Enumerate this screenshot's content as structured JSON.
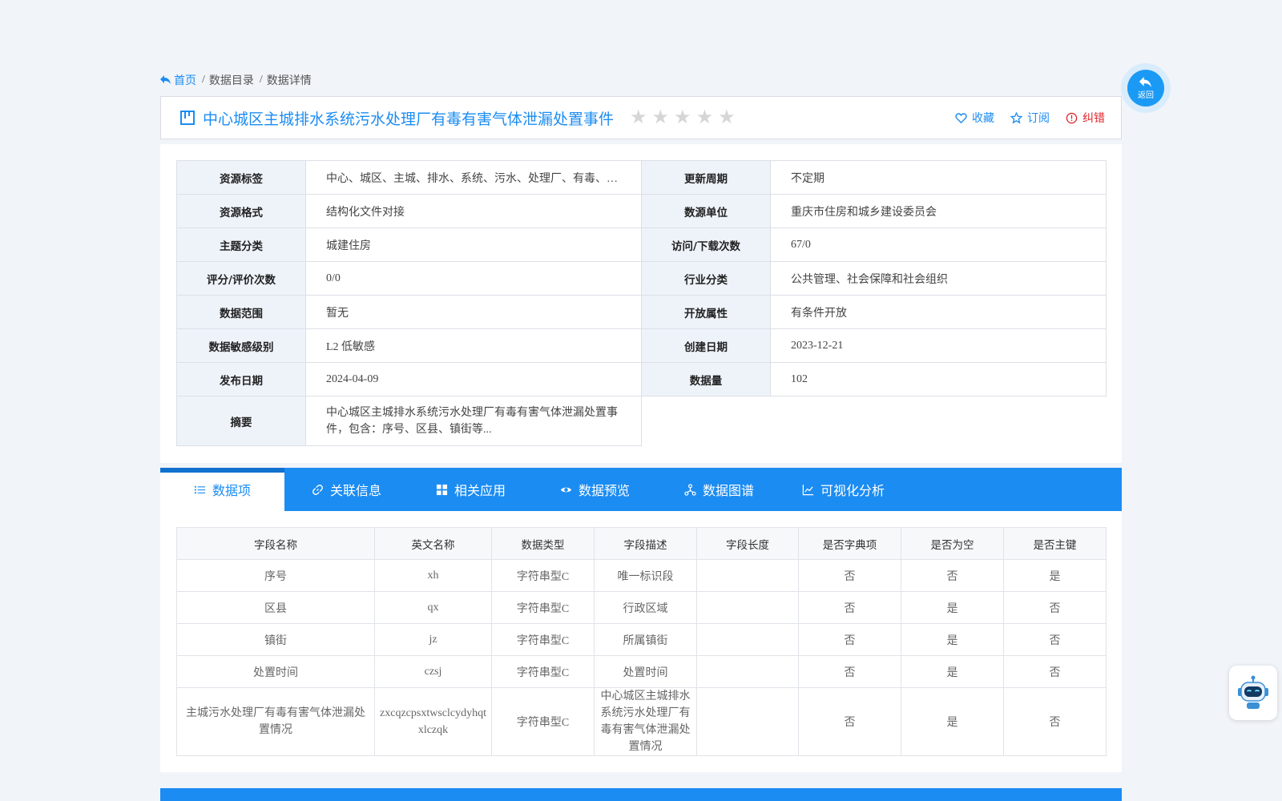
{
  "breadcrumb": {
    "home": "首页",
    "catalog": "数据目录",
    "detail": "数据详情",
    "sep": "/"
  },
  "title": {
    "text": "中心城区主城排水系统污水处理厂有毒有害气体泄漏处置事件",
    "rating_stars": 0,
    "rating_max": 5
  },
  "actions": {
    "favorite": "收藏",
    "subscribe": "订阅",
    "report": "纠错"
  },
  "back": {
    "label": "返回"
  },
  "info": {
    "rows": [
      {
        "l1": "资源标签",
        "v1": "中心、城区、主城、排水、系统、污水、处理厂、有毒、有害、气体、泄漏、处置、事件",
        "l2": "更新周期",
        "v2": "不定期"
      },
      {
        "l1": "资源格式",
        "v1": "结构化文件对接",
        "l2": "数源单位",
        "v2": "重庆市住房和城乡建设委员会"
      },
      {
        "l1": "主题分类",
        "v1": "城建住房",
        "l2": "访问/下载次数",
        "v2": "67/0"
      },
      {
        "l1": "评分/评价次数",
        "v1": "0/0",
        "l2": "行业分类",
        "v2": "公共管理、社会保障和社会组织"
      },
      {
        "l1": "数据范围",
        "v1": "暂无",
        "l2": "开放属性",
        "v2": "有条件开放"
      },
      {
        "l1": "数据敏感级别",
        "v1": "L2 低敏感",
        "l2": "创建日期",
        "v2": "2023-12-21"
      },
      {
        "l1": "发布日期",
        "v1": "2024-04-09",
        "l2": "数据量",
        "v2": "102"
      }
    ],
    "summary_label": "摘要",
    "summary_line1": "中心城区主城排水系统污水处理厂有毒有害气体泄漏处置事",
    "summary_line2": "件，包含：序号、区县、镇街等..."
  },
  "tabs": [
    "数据项",
    "关联信息",
    "相关应用",
    "数据预览",
    "数据图谱",
    "可视化分析"
  ],
  "fields": {
    "headers": [
      "字段名称",
      "英文名称",
      "数据类型",
      "字段描述",
      "字段长度",
      "是否字典项",
      "是否为空",
      "是否主键"
    ],
    "rows": [
      [
        "序号",
        "xh",
        "字符串型C",
        "唯一标识段",
        "",
        "否",
        "否",
        "是"
      ],
      [
        "区县",
        "qx",
        "字符串型C",
        "行政区域",
        "",
        "否",
        "是",
        "否"
      ],
      [
        "镇街",
        "jz",
        "字符串型C",
        "所属镇街",
        "",
        "否",
        "是",
        "否"
      ],
      [
        "处置时间",
        "czsj",
        "字符串型C",
        "处置时间",
        "",
        "否",
        "是",
        "否"
      ]
    ],
    "last_row": {
      "name_line1": "主城污水处理厂有毒有害气体泄漏处",
      "name_line2": "置情况",
      "en_line1": "zxcqzcpsxtwsclcydyhqt",
      "en_line2": "xlczqk",
      "type": "字符串型C",
      "desc_line1": "中心城区主城排水",
      "desc_line2": "系统污水处理厂有",
      "desc_line3": "毒有害气体泄漏处",
      "desc_line4": "置情况",
      "length": "",
      "dict": "否",
      "nullable": "是",
      "pk": "否"
    }
  },
  "colors": {
    "accent": "#1b8cf2",
    "danger": "#e0252b",
    "page_bg": "#f1f4f9"
  },
  "icons": [
    "back-arrow-icon",
    "board-icon",
    "star-icon",
    "heart-icon",
    "star-outline-icon",
    "alert-circle-icon",
    "list-icon",
    "link-icon",
    "grid-icon",
    "eye-icon",
    "graph-icon",
    "line-chart-icon",
    "robot-icon"
  ]
}
